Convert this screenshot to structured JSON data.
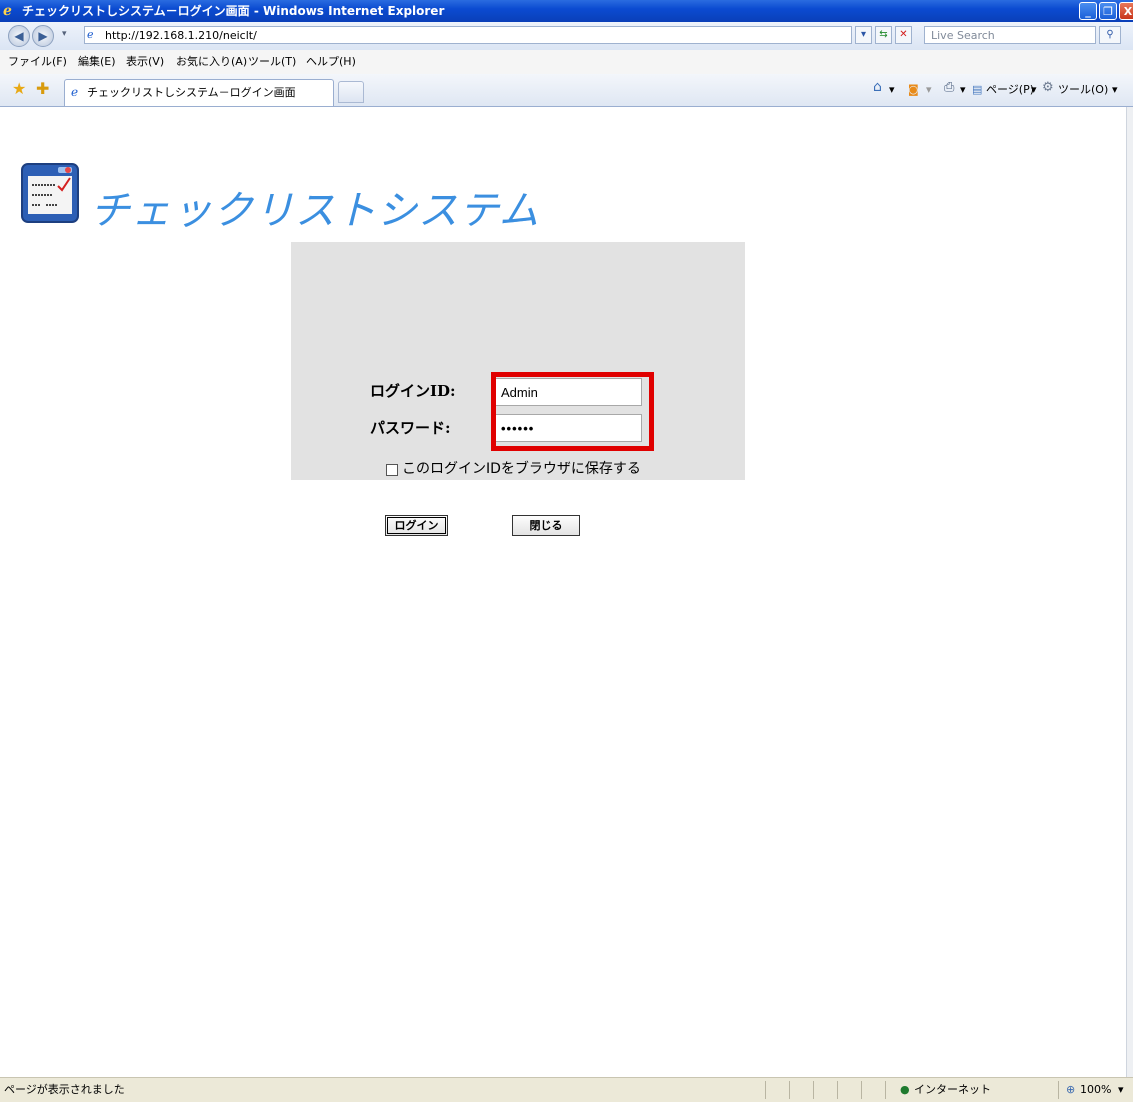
{
  "window": {
    "title": "チェックリストしシステム－ログイン画面 - Windows Internet Explorer",
    "controls": {
      "minimize": "_",
      "maximize": "❐",
      "close": "X"
    }
  },
  "address_bar": {
    "url": "http://192.168.1.210/neiclt/",
    "search_placeholder": "Live Search"
  },
  "menu": [
    "ファイル(F)",
    "編集(E)",
    "表示(V)",
    "お気に入り(A)",
    "ツール(T)",
    "ヘルプ(H)"
  ],
  "tab": {
    "label": "チェックリストしシステム－ログイン画面"
  },
  "command_bar": {
    "page": "ページ(P)",
    "tools": "ツール(O)"
  },
  "app": {
    "title": "チェックリストシステム"
  },
  "login": {
    "id_label": "ログインID:",
    "id_value": "Admin",
    "password_label": "パスワード:",
    "password_value": "••••••",
    "remember_label": "このログインIDをブラウザに保存する",
    "remember_checked": false,
    "login_button": "ログイン",
    "close_button": "閉じる"
  },
  "status": {
    "message": "ページが表示されました",
    "zone": "インターネット",
    "zoom": "100%"
  },
  "colors": {
    "title_accent": "#3b8fe0",
    "highlight_border": "#e00000",
    "panel_bg": "#e2e2e2"
  }
}
